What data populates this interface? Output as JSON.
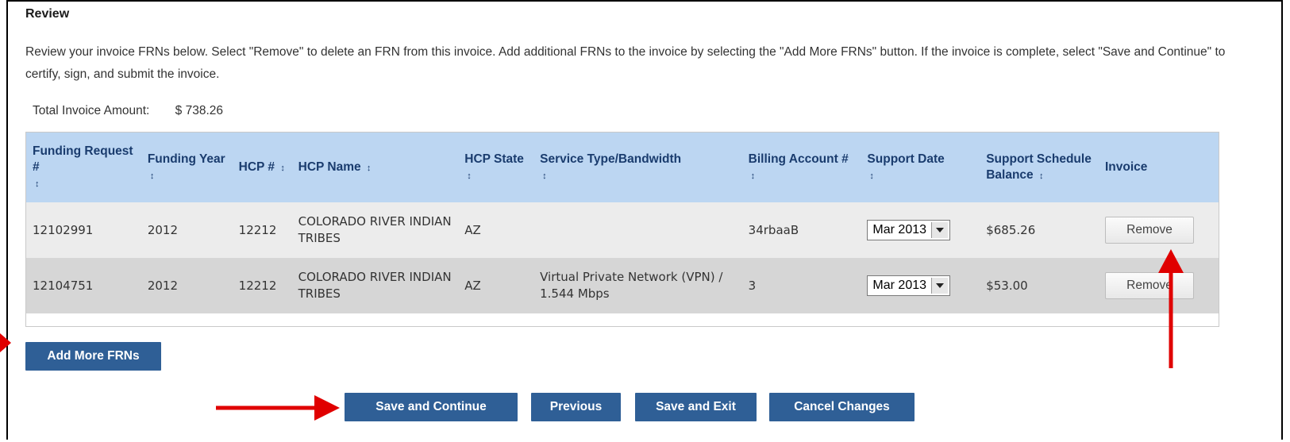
{
  "section": {
    "title": "Review"
  },
  "intro": "Review your invoice FRNs below. Select \"Remove\" to delete an FRN from this invoice. Add additional FRNs to the invoice by selecting the \"Add More FRNs\" button. If the invoice is complete, select \"Save and Continue\" to certify, sign, and submit the invoice.",
  "total": {
    "label": "Total Invoice Amount:",
    "value": "$ 738.26"
  },
  "table": {
    "columns": [
      {
        "label": "Funding Request #",
        "sort_icon": "↕"
      },
      {
        "label": "Funding Year",
        "sort_icon": "↕"
      },
      {
        "label": "HCP #",
        "sort_icon": "↕"
      },
      {
        "label": "HCP Name",
        "sort_icon": "↕"
      },
      {
        "label": "HCP State",
        "sort_icon": "↕"
      },
      {
        "label": "Service Type/Bandwidth",
        "sort_icon": "↕"
      },
      {
        "label": "Billing Account #",
        "sort_icon": "↕"
      },
      {
        "label": "Support Date",
        "sort_icon": "↕"
      },
      {
        "label": "Support Schedule Balance",
        "sort_icon": "↕"
      },
      {
        "label": "Invoice"
      }
    ],
    "rows": [
      {
        "frn": "12102991",
        "year": "2012",
        "hcp": "12212",
        "hcp_name": "COLORADO RIVER INDIAN TRIBES",
        "state": "AZ",
        "service": "",
        "billing": "34rbaaB",
        "support_date": "Mar 2013",
        "balance": "$685.26",
        "action": "Remove"
      },
      {
        "frn": "12104751",
        "year": "2012",
        "hcp": "12212",
        "hcp_name": "COLORADO RIVER INDIAN TRIBES",
        "state": "AZ",
        "service": "Virtual Private Network (VPN) / 1.544 Mbps",
        "billing": "3",
        "support_date": "Mar 2013",
        "balance": "$53.00",
        "action": "Remove"
      }
    ]
  },
  "buttons": {
    "add_more": "Add More FRNs",
    "save_continue": "Save and Continue",
    "previous": "Previous",
    "save_exit": "Save and Exit",
    "cancel": "Cancel Changes"
  },
  "colors": {
    "header_bg": "#bcd6f2",
    "button_bg": "#2f5f96",
    "annotation_arrow": "#e00000"
  },
  "icons": {
    "sort": "sort-icon",
    "dropdown": "chevron-down-icon",
    "annotation": "red-arrow-icon"
  }
}
